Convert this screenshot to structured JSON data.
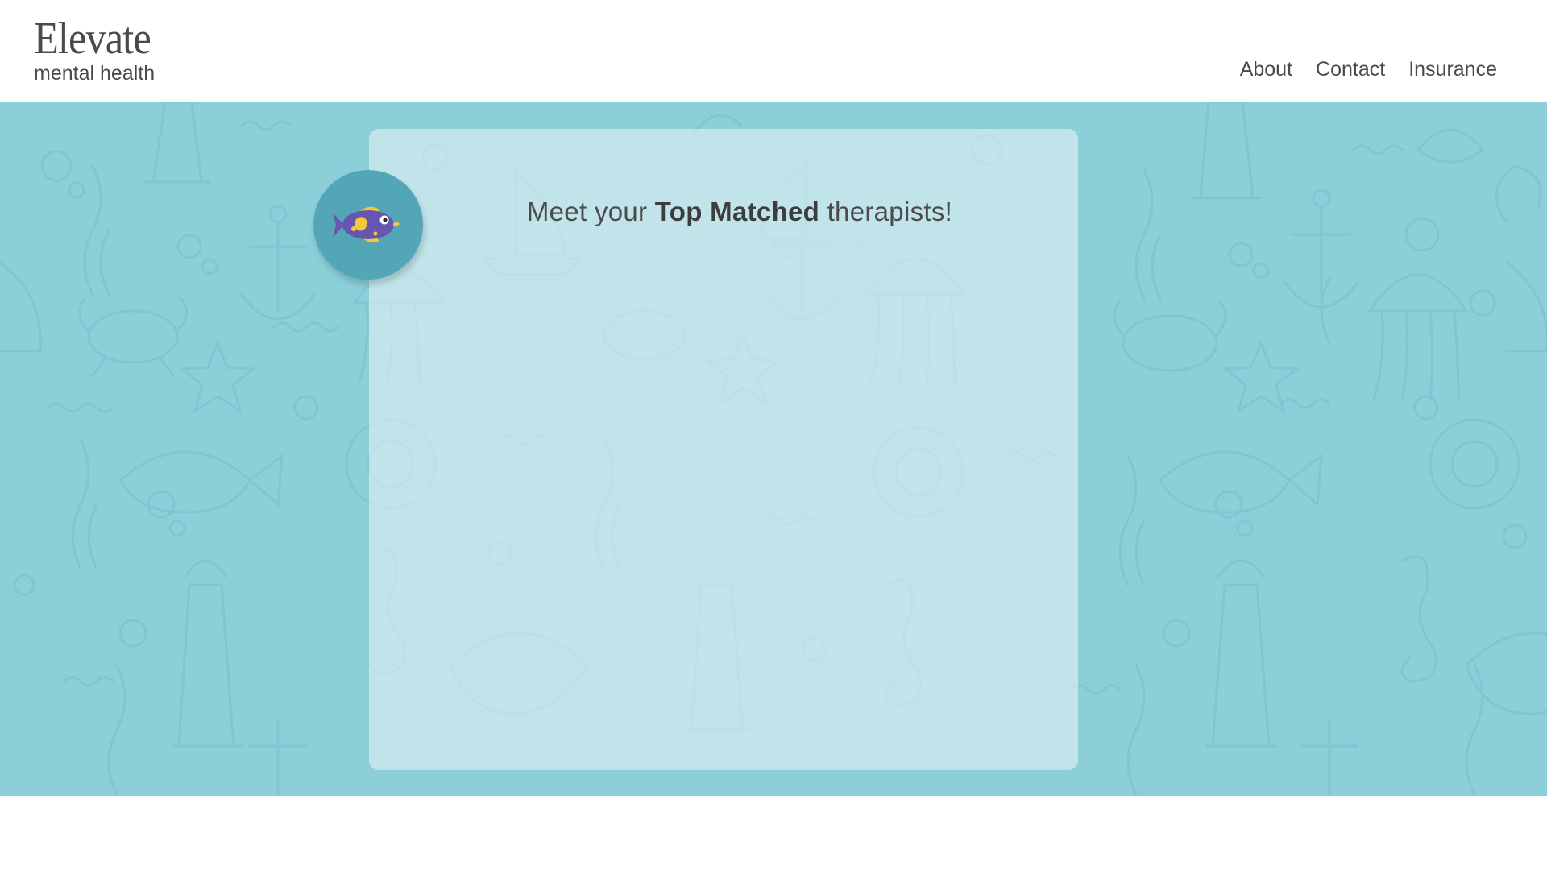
{
  "brand": {
    "title": "Elevate",
    "subtitle": "mental health"
  },
  "nav": {
    "items": [
      {
        "label": "About"
      },
      {
        "label": "Contact"
      },
      {
        "label": "Insurance"
      }
    ]
  },
  "hero": {
    "headline_pre": "Meet your ",
    "headline_strong": "Top Matched",
    "headline_post": " therapists!",
    "avatar_icon": "fish-icon",
    "background_color": "#8ccfd9",
    "card_color": "#d8eef2",
    "avatar_color": "#52a6b5"
  }
}
